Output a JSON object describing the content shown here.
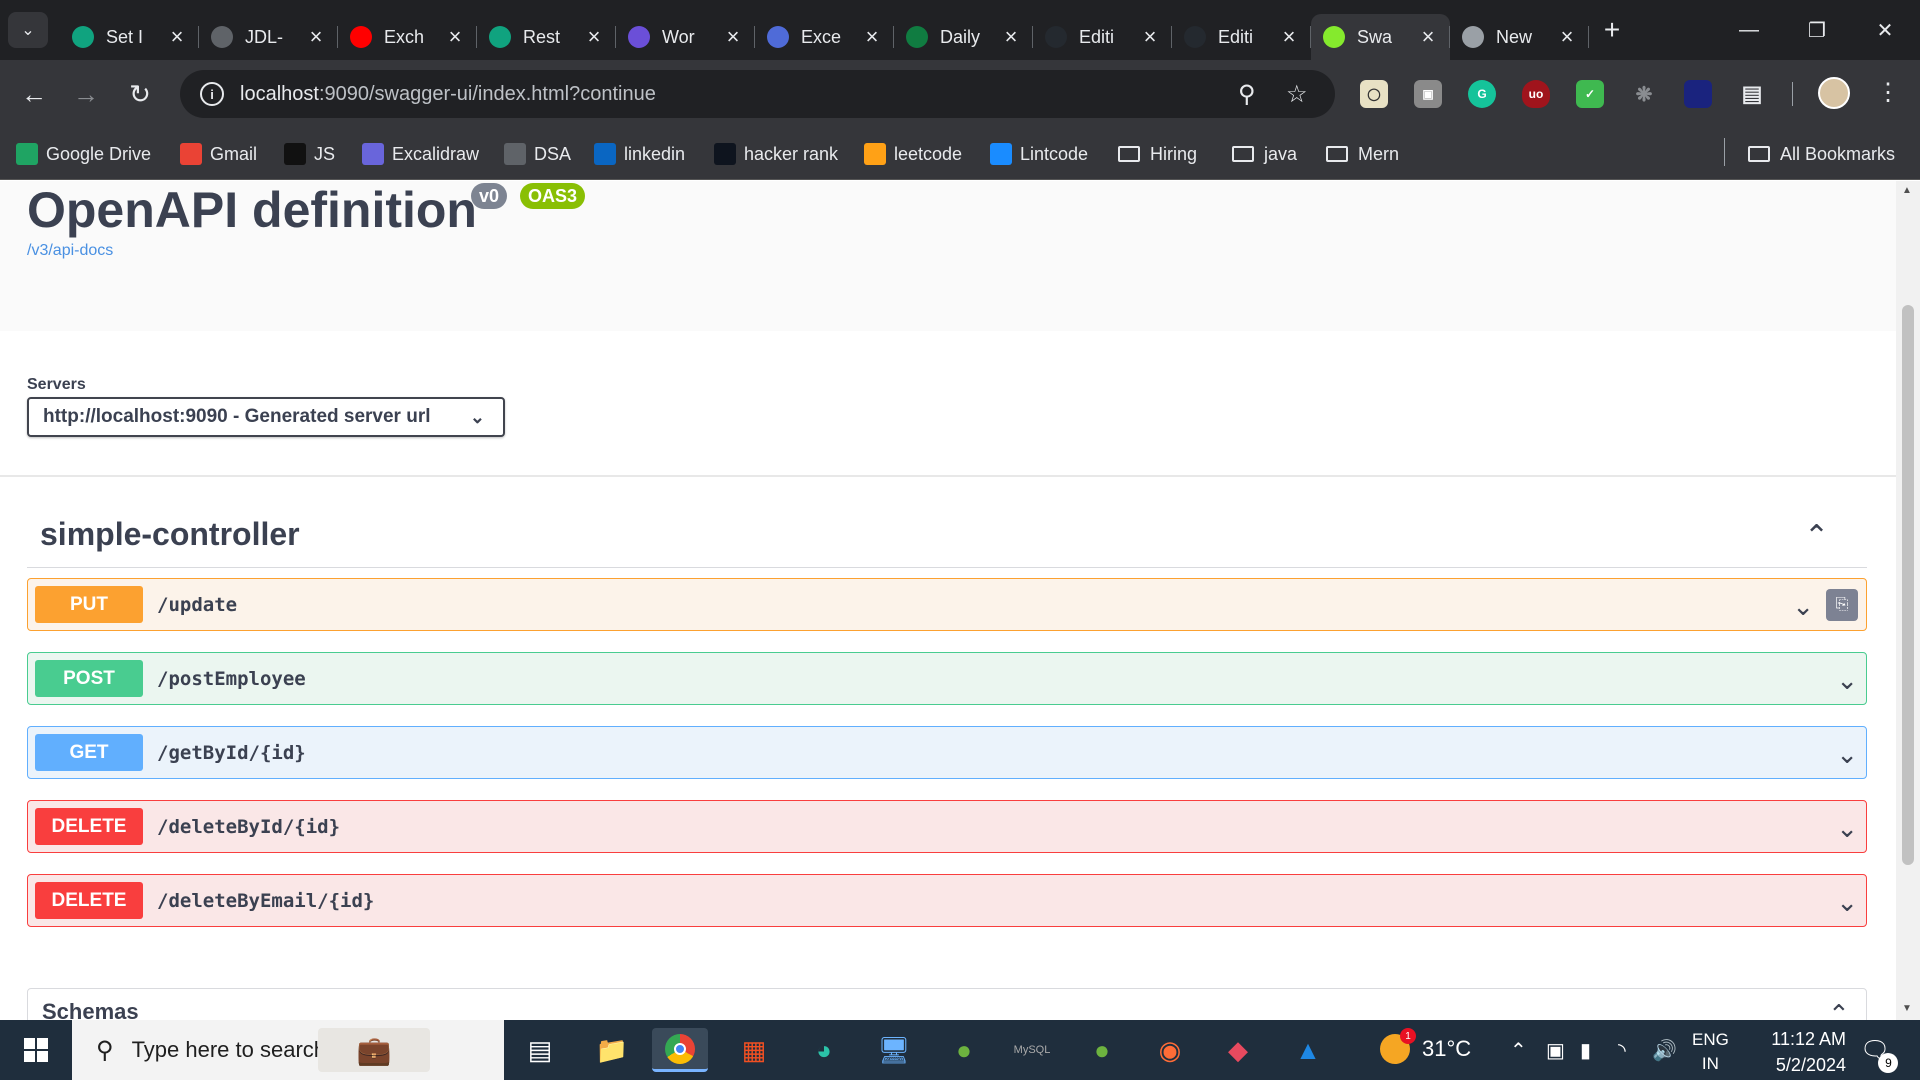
{
  "browser": {
    "tabs": [
      {
        "title": "Set I",
        "favicon": "chatgpt-icon",
        "color": "#10a37f"
      },
      {
        "title": "JDL-",
        "favicon": "chatgpt-icon",
        "color": "#5f6368"
      },
      {
        "title": "Exch",
        "favicon": "youtube-icon",
        "color": "#ff0000"
      },
      {
        "title": "Rest",
        "favicon": "chatgpt-icon",
        "color": "#10a37f"
      },
      {
        "title": "Wor",
        "favicon": "copilot-icon",
        "color": "#6b4fd8"
      },
      {
        "title": "Exce",
        "favicon": "copilot-icon",
        "color": "#4f6bd8"
      },
      {
        "title": "Daily",
        "favicon": "excel-icon",
        "color": "#107c41"
      },
      {
        "title": "Editi",
        "favicon": "github-icon",
        "color": "#24292f"
      },
      {
        "title": "Editi",
        "favicon": "github-icon",
        "color": "#24292f"
      },
      {
        "title": "Swa",
        "favicon": "swagger-icon",
        "color": "#85ea2d"
      },
      {
        "title": "New",
        "favicon": "chrome-icon",
        "color": "#9aa0a6"
      }
    ],
    "active_tab_index": 9,
    "url_host": "localhost",
    "url_rest": ":9090/swagger-ui/index.html?continue",
    "bookmarks": [
      {
        "label": "Google Drive",
        "icon": "google-drive-icon"
      },
      {
        "label": "Gmail",
        "icon": "gmail-icon"
      },
      {
        "label": "JS",
        "icon": "notion-icon"
      },
      {
        "label": "Excalidraw",
        "icon": "excalidraw-icon"
      },
      {
        "label": "DSA",
        "icon": "globe-icon"
      },
      {
        "label": "linkedin",
        "icon": "linkedin-icon"
      },
      {
        "label": "hacker rank",
        "icon": "hackerrank-icon"
      },
      {
        "label": "leetcode",
        "icon": "leetcode-icon"
      },
      {
        "label": "Lintcode",
        "icon": "lintcode-icon"
      },
      {
        "label": "Hiring",
        "icon": "folder-icon"
      },
      {
        "label": "java",
        "icon": "folder-icon"
      },
      {
        "label": "Mern",
        "icon": "folder-icon"
      }
    ],
    "all_bookmarks_label": "All Bookmarks"
  },
  "swagger": {
    "title": "OpenAPI definition",
    "version_badge": "v0",
    "oas_badge": "OAS3",
    "api_docs_link": "/v3/api-docs",
    "servers_label": "Servers",
    "server_selected": "http://localhost:9090 - Generated server url",
    "tag_name": "simple-controller",
    "operations": [
      {
        "method": "PUT",
        "path": "/update"
      },
      {
        "method": "POST",
        "path": "/postEmployee"
      },
      {
        "method": "GET",
        "path": "/getById/{id}"
      },
      {
        "method": "DELETE",
        "path": "/deleteById/{id}"
      },
      {
        "method": "DELETE",
        "path": "/deleteByEmail/{id}"
      }
    ],
    "schemas_title": "Schemas"
  },
  "taskbar": {
    "search_placeholder": "Type here to search",
    "temperature": "31°C",
    "weather_badge": "1",
    "language_top": "ENG",
    "language_bottom": "IN",
    "time": "11:12 AM",
    "date": "5/2/2024",
    "notification_count": "9"
  }
}
